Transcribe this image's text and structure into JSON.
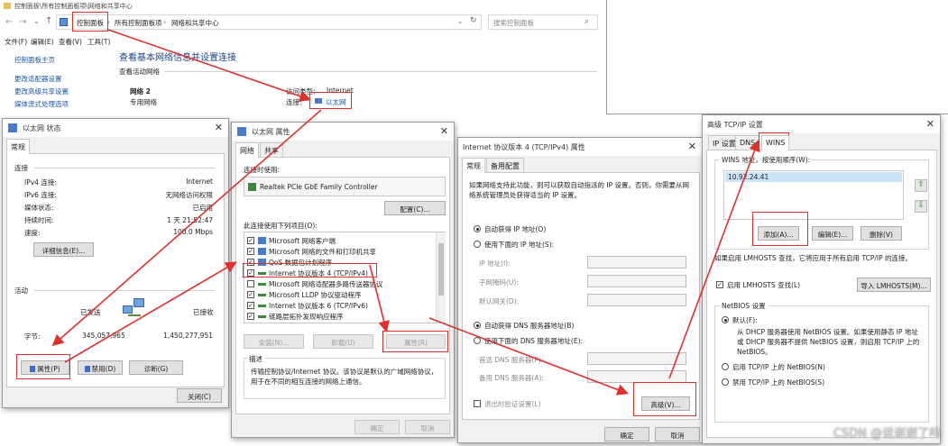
{
  "cp": {
    "titlebar": "控制面板\\所有控制面板项\\网络和共享中心",
    "breadcrumb": [
      "控制面板",
      "所有控制面板项",
      "网络和共享中心"
    ],
    "search_placeholder": "搜索控制面板",
    "menu": [
      "文件(F)",
      "编辑(E)",
      "查看(V)",
      "工具(T)"
    ],
    "side_links": [
      "控制面板主页",
      "更改适配器设置",
      "更改高级共享设置",
      "媒体流式处理选项"
    ],
    "heading": "查看基本网络信息并设置连接",
    "active_networks": "查看活动网络",
    "network_name": "网络 2",
    "network_type": "专用网络",
    "access_type_label": "访问类型:",
    "access_type_value": "Internet",
    "connection_label": "连接:",
    "connection_value": "以太网"
  },
  "status": {
    "title": "以太网 状态",
    "tab": "常规",
    "section_connection": "连接",
    "rows": [
      {
        "label": "IPv4 连接:",
        "value": "Internet"
      },
      {
        "label": "IPv6 连接:",
        "value": "无网络访问权限"
      },
      {
        "label": "媒体状态:",
        "value": "已启用"
      },
      {
        "label": "持续时间:",
        "value": "1 天 21:52:47"
      },
      {
        "label": "速度:",
        "value": "100.0 Mbps"
      }
    ],
    "details_btn": "详细信息(E)...",
    "section_activity": "活动",
    "sent": "已发送",
    "received": "已接收",
    "bytes_label": "字节:",
    "bytes_sent": "345,057,965",
    "bytes_received": "1,450,277,951",
    "properties_btn": "属性(P)",
    "disable_btn": "禁用(D)",
    "diagnose_btn": "诊断(G)",
    "close_btn": "关闭(C)"
  },
  "props": {
    "title": "以太网 属性",
    "tabs": [
      "网络",
      "共享"
    ],
    "connect_using_label": "连接时使用:",
    "adapter": "Realtek PCIe GbE Family Controller",
    "configure_btn": "配置(C)...",
    "items_label": "此连接使用下列项目(O):",
    "items": [
      "Microsoft 网络客户端",
      "Microsoft 网络的文件和打印机共享",
      "QoS 数据包计划程序",
      "Internet 协议版本 4 (TCP/IPv4)",
      "Microsoft 网络适配器多路传送器协议",
      "Microsoft LLDP 协议驱动程序",
      "Internet 协议版本 6 (TCP/IPv6)",
      "链路层拓扑发现响应程序"
    ],
    "install_btn": "安装(N)...",
    "uninstall_btn": "卸载(U)",
    "properties_btn": "属性(R)",
    "desc_label": "描述",
    "desc_text": "传输控制协议/Internet 协议。该协议是默认的广域网络协议，用于在不同的相互连接的网络上通信。",
    "ok_btn": "确定",
    "cancel_btn": "取消"
  },
  "ipv4": {
    "title": "Internet 协议版本 4 (TCP/IPv4) 属性",
    "tabs": [
      "常规",
      "备用配置"
    ],
    "intro": "如果网络支持此功能，则可以获取自动指派的 IP 设置。否则，你需要从网络系统管理员处获得适当的 IP 设置。",
    "auto_ip": "自动获得 IP 地址(O)",
    "manual_ip": "使用下面的 IP 地址(S):",
    "ip_label": "IP 地址(I):",
    "mask_label": "子网掩码(U):",
    "gateway_label": "默认网关(D):",
    "auto_dns": "自动获得 DNS 服务器地址(B)",
    "manual_dns": "使用下面的 DNS 服务器地址(E):",
    "pref_dns_label": "首选 DNS 服务器(P):",
    "alt_dns_label": "备用 DNS 服务器(A):",
    "validate_label": "退出时验证设置(L)",
    "advanced_btn": "高级(V)...",
    "ok_btn": "确定",
    "cancel_btn": "取消"
  },
  "adv": {
    "title": "高级 TCP/IP 设置",
    "tabs": [
      "IP 设置",
      "DNS",
      "WINS"
    ],
    "wins_label": "WINS 地址，按使用顺序(W):",
    "wins_address": "10.92.24.41",
    "add_btn": "添加(A)...",
    "edit_btn": "编辑(E)...",
    "remove_btn": "删除(V)",
    "lmhosts_info": "如果启用 LMHOSTS 查找，它将应用于所有启用 TCP/IP 的连接。",
    "lmhosts_check": "启用 LMHOSTS 查找(L)",
    "import_btn": "导入 LMHOSTS(M)...",
    "netbios_label": "NetBIOS 设置",
    "default_opt": "默认(F):",
    "default_desc": "从 DHCP 服务器使用 NetBIOS 设置。如果使用静态 IP 地址或 DHCP 服务器不提供 NetBIOS 设置，则启用 TCP/IP 上的 NetBIOS。",
    "enable_opt": "启用 TCP/IP 上的 NetBIOS(N)",
    "disable_opt": "禁用 TCP/IP 上的 NetBIOS(S)"
  },
  "watermark": "CSDN @说谢谢了吗",
  "colors": {
    "annotation_red": "#e0302b",
    "link_blue": "#1a54a8",
    "selection_blue": "#cce4f7"
  }
}
